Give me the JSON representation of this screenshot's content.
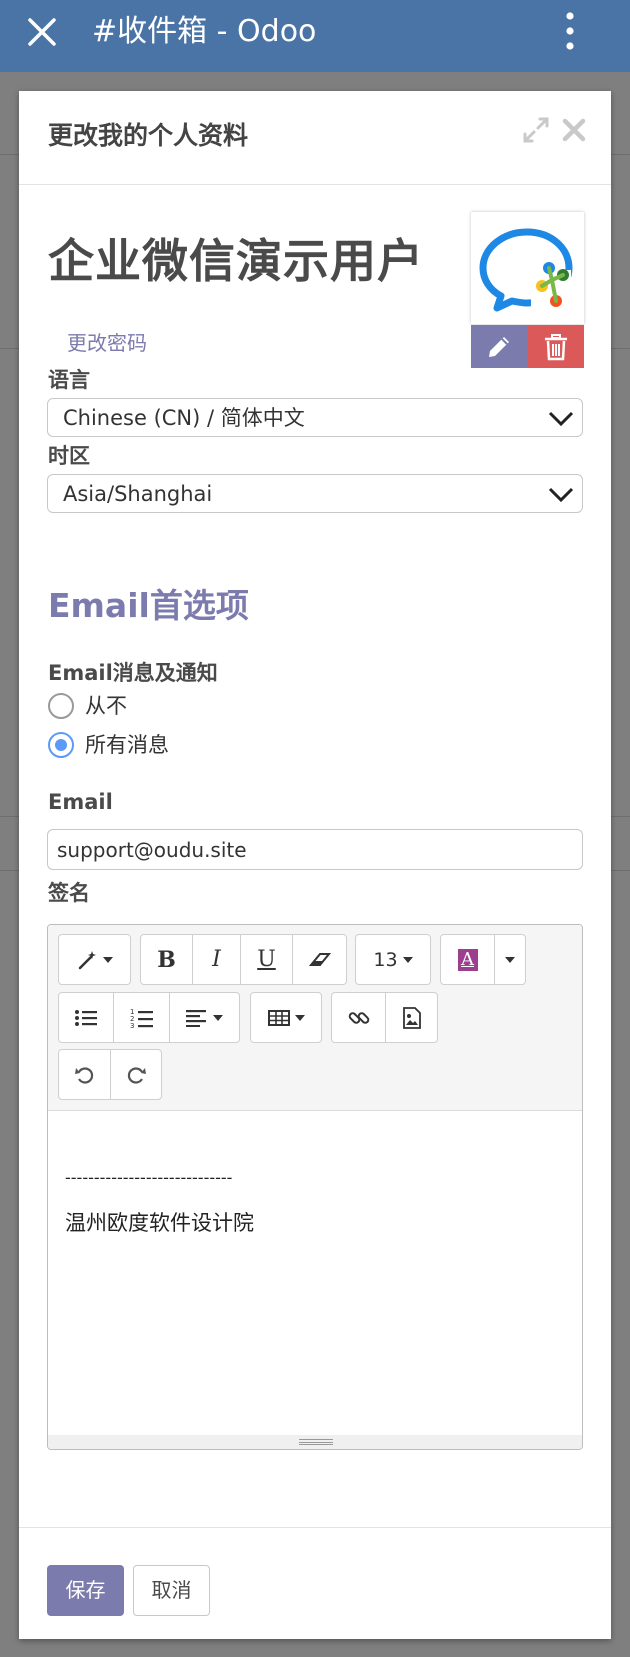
{
  "topbar": {
    "title": "#收件箱 - Odoo"
  },
  "dialog": {
    "title": "更改我的个人资料",
    "user_name": "企业微信演示用户",
    "change_password": "更改密码",
    "language": {
      "label": "语言",
      "value": "Chinese (CN) / 简体中文"
    },
    "timezone": {
      "label": "时区",
      "value": "Asia/Shanghai"
    },
    "email_prefs": {
      "section_title": "Email首选项",
      "notification_label": "Email消息及通知",
      "options": [
        {
          "label": "从不",
          "selected": false
        },
        {
          "label": "所有消息",
          "selected": true
        }
      ]
    },
    "email": {
      "label": "Email",
      "value": "support@oudu.site"
    },
    "signature": {
      "label": "签名",
      "toolbar": {
        "bold": "B",
        "italic": "I",
        "underline": "U",
        "font_size": "13",
        "color_letter": "A"
      },
      "lines": [
        "-----------------------------",
        "温州欧度软件设计院"
      ]
    },
    "buttons": {
      "save": "保存",
      "cancel": "取消"
    }
  },
  "colors": {
    "topbar": "#4b74a6",
    "accent": "#7c7bad",
    "danger": "#dc5959",
    "radio_selected": "#5b9bf7"
  }
}
